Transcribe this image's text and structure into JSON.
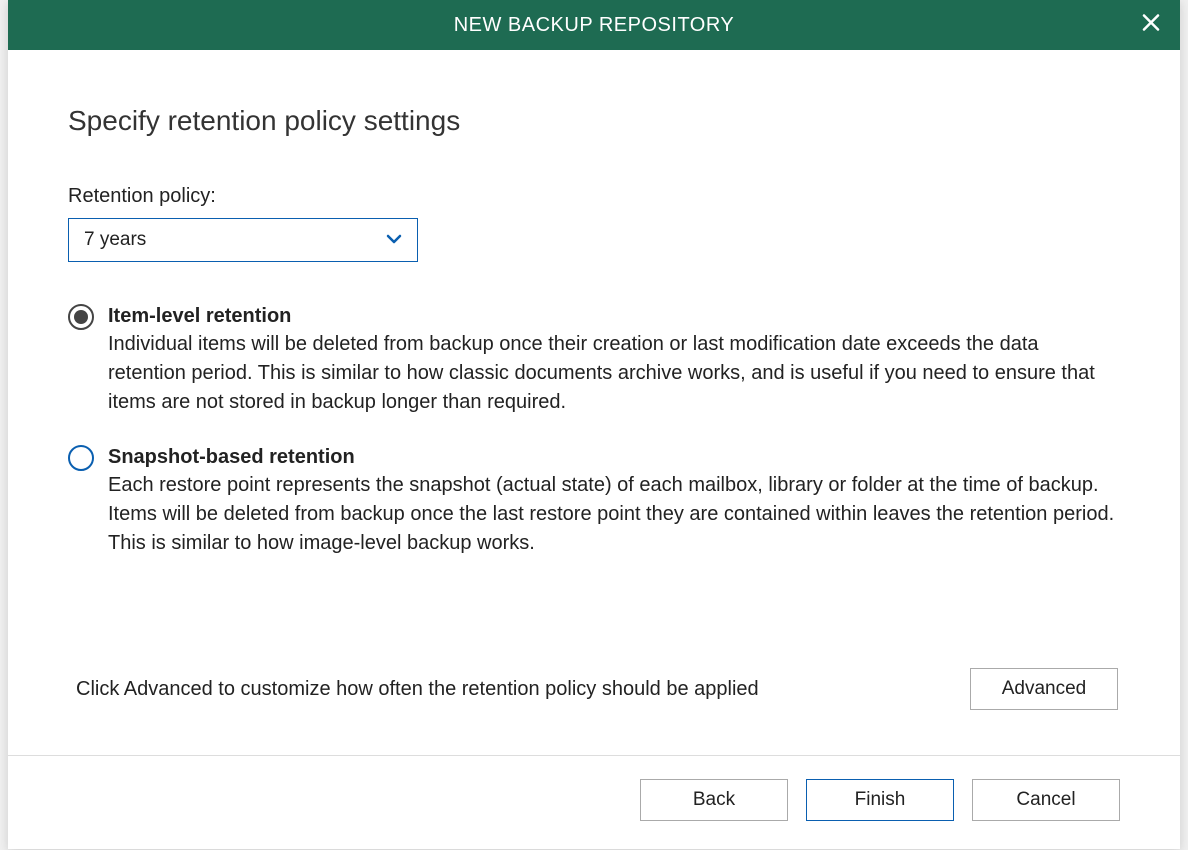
{
  "titlebar": {
    "title": "NEW BACKUP REPOSITORY"
  },
  "heading": "Specify retention policy settings",
  "retention": {
    "label": "Retention policy:",
    "value": "7 years"
  },
  "options": [
    {
      "title": "Item-level retention",
      "description": "Individual items will be deleted from backup once their creation or last modification date exceeds the data retention period. This is similar to how classic documents archive works, and is useful if you need to ensure that items are not stored in backup longer than required.",
      "selected": true
    },
    {
      "title": "Snapshot-based retention",
      "description": "Each restore point represents the snapshot (actual state) of each mailbox, library or folder at the time of backup. Items will be deleted from backup once the last restore point they are contained within leaves the retention period. This is similar to how image-level backup works.",
      "selected": false
    }
  ],
  "advanced": {
    "text": "Click Advanced to customize how often the retention policy should be applied",
    "button": "Advanced"
  },
  "buttons": {
    "back": "Back",
    "finish": "Finish",
    "cancel": "Cancel"
  }
}
